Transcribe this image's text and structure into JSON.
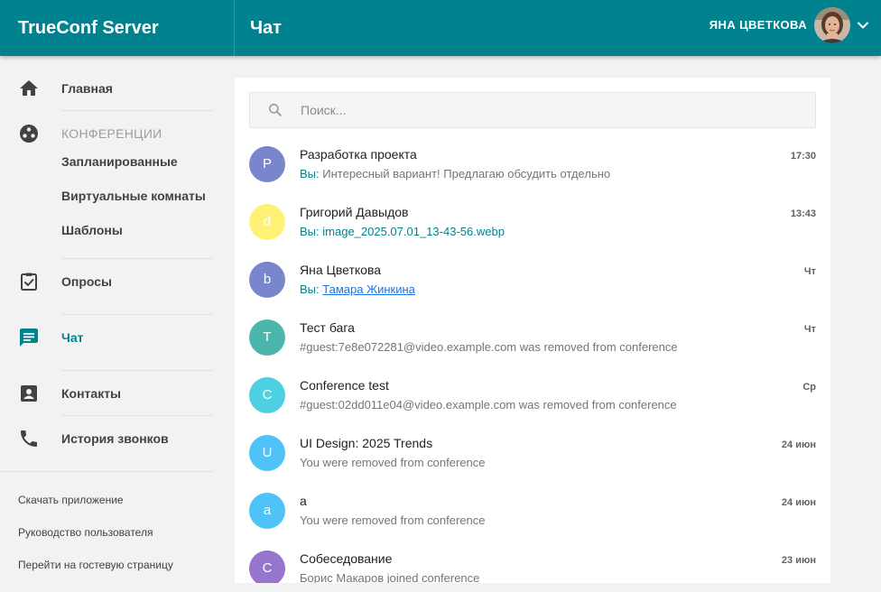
{
  "app": {
    "brand": "TrueConf Server",
    "page_title": "Чат"
  },
  "user": {
    "name": "ЯНА ЦВЕТКОВА"
  },
  "sidebar": {
    "home": "Главная",
    "conferences": "КОНФЕРЕНЦИИ",
    "scheduled": "Запланированные",
    "virtual_rooms": "Виртуальные комнаты",
    "templates": "Шаблоны",
    "polls": "Опросы",
    "chat": "Чат",
    "contacts": "Контакты",
    "call_history": "История звонков",
    "footer": {
      "download": "Скачать приложение",
      "manual": "Руководство пользователя",
      "guest_page": "Перейти на гостевую страницу"
    }
  },
  "search": {
    "placeholder": "Поиск..."
  },
  "chats": [
    {
      "initial": "P",
      "color": "#7986cb",
      "name": "Разработка проекта",
      "time": "17:30",
      "prefix": "Вы:",
      "preview": "Интересный вариант! Предлагаю обсудить отдельно"
    },
    {
      "initial": "d",
      "color": "#fff176",
      "name": "Григорий Давыдов",
      "time": "13:43",
      "prefix": "Вы:",
      "preview": "image_2025.07.01_13-43-56.webp"
    },
    {
      "initial": "b",
      "color": "#7986cb",
      "name": "Яна Цветкова",
      "time": "Чт",
      "prefix": "Вы:",
      "preview": "Тамара Жинкина"
    },
    {
      "initial": "T",
      "color": "#4db6ac",
      "name": "Тест бага",
      "time": "Чт",
      "preview": "#guest:7e8e072281@video.example.com was removed from conference"
    },
    {
      "initial": "C",
      "color": "#4dd0e1",
      "name": "Conference test",
      "time": "Ср",
      "preview": "#guest:02dd011e04@video.example.com was removed from conference"
    },
    {
      "initial": "U",
      "color": "#4fc3f7",
      "name": "UI Design: 2025 Trends",
      "time": "24 июн",
      "preview": "You were removed from conference"
    },
    {
      "initial": "a",
      "color": "#4fc3f7",
      "name": "a",
      "time": "24 июн",
      "preview": "You were removed from conference"
    },
    {
      "initial": "C",
      "color": "#9575cd",
      "name": "Собеседование",
      "time": "23 июн",
      "preview": "Борис Макаров joined conference"
    }
  ]
}
